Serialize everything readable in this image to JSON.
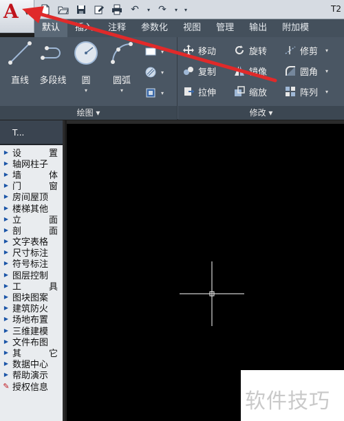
{
  "title_bar": {
    "title": "T2"
  },
  "ribbon_tabs": [
    {
      "label": "默认",
      "active": true
    },
    {
      "label": "插入"
    },
    {
      "label": "注释"
    },
    {
      "label": "参数化"
    },
    {
      "label": "视图"
    },
    {
      "label": "管理"
    },
    {
      "label": "输出"
    },
    {
      "label": "附加模"
    }
  ],
  "draw_panel": {
    "footer": "绘图 ▾",
    "tools": [
      {
        "label": "直线",
        "icon": "line-icon"
      },
      {
        "label": "多段线",
        "icon": "polyline-icon"
      },
      {
        "label": "圆",
        "icon": "circle-icon"
      },
      {
        "label": "圆弧",
        "icon": "arc-icon"
      }
    ]
  },
  "modify_panel": {
    "footer": "修改 ▾",
    "row1": [
      "移动",
      "旋转",
      "修剪"
    ],
    "row2": [
      "复制",
      "镜像",
      "圆角"
    ],
    "row3": [
      "拉伸",
      "缩放",
      "阵列"
    ]
  },
  "palette": {
    "header": "T...",
    "items": [
      "设置",
      "轴网柱子",
      "墙体",
      "门窗",
      "房间屋顶",
      "楼梯其他",
      "立面",
      "剖面",
      "文字表格",
      "尺寸标注",
      "符号标注",
      "图层控制",
      "工具",
      "图块图案",
      "建筑防火",
      "场地布置",
      "三维建模",
      "文件布图",
      "其它",
      "数据中心",
      "帮助演示",
      "授权信息"
    ]
  },
  "watermark": {
    "text": "软件技巧"
  },
  "colors": {
    "annotation_arrow": "#e02a2a",
    "logo": "#c0141c",
    "canvas": "#000000"
  }
}
